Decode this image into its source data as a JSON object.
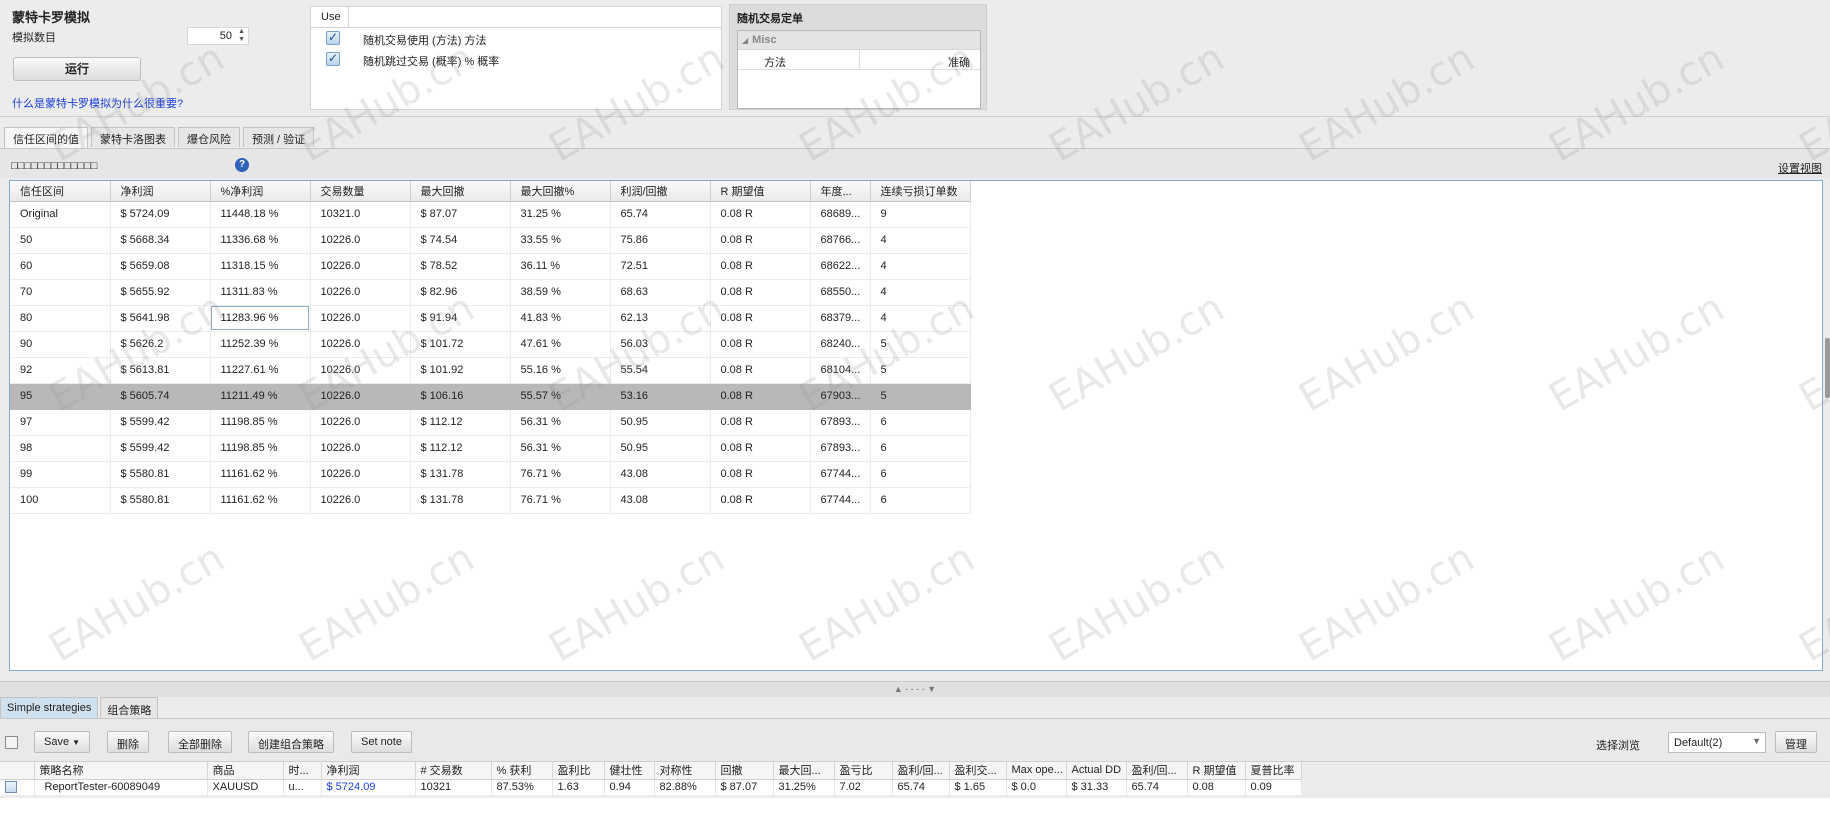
{
  "montecarlo": {
    "title": "蒙特卡罗模拟",
    "count_label": "模拟数目",
    "count_value": "50",
    "run_label": "运行",
    "why_link": "什么是蒙特卡罗模拟为什么很重要?"
  },
  "use_panel": {
    "header": "Use",
    "options": [
      {
        "label": "随机交易使用 (方法) 方法",
        "checked": true
      },
      {
        "label": "随机跳过交易 (概率) % 概率",
        "checked": true
      }
    ]
  },
  "random_panel": {
    "title": "随机交易定单",
    "category": "Misc",
    "row_key": "方法",
    "row_value": "准确"
  },
  "tabs": [
    "信任区间的值",
    "蒙特卡洛图表",
    "爆仓风险",
    "预测 / 验证"
  ],
  "subbar": {
    "placeholder_text": "□□□□□□□□□□□□□",
    "set_view": "设置视图"
  },
  "grid": {
    "columns": [
      "信任区间",
      "净利润",
      "%净利润",
      "交易数量",
      "最大回撤",
      "最大回撤%",
      "利润/回撤",
      "R 期望值",
      "年度...",
      "连续亏损订单数"
    ],
    "rows": [
      [
        "Original",
        "$ 5724.09",
        "11448.18 %",
        "10321.0",
        "$ 87.07",
        "31.25 %",
        "65.74",
        "0.08 R",
        "68689...",
        "9"
      ],
      [
        "50",
        "$ 5668.34",
        "11336.68 %",
        "10226.0",
        "$ 74.54",
        "33.55 %",
        "75.86",
        "0.08 R",
        "68766...",
        "4"
      ],
      [
        "60",
        "$ 5659.08",
        "11318.15 %",
        "10226.0",
        "$ 78.52",
        "36.11 %",
        "72.51",
        "0.08 R",
        "68622...",
        "4"
      ],
      [
        "70",
        "$ 5655.92",
        "11311.83 %",
        "10226.0",
        "$ 82.96",
        "38.59 %",
        "68.63",
        "0.08 R",
        "68550...",
        "4"
      ],
      [
        "80",
        "$ 5641.98",
        "11283.96 %",
        "10226.0",
        "$ 91.94",
        "41.83 %",
        "62.13",
        "0.08 R",
        "68379...",
        "4"
      ],
      [
        "90",
        "$ 5626.2",
        "11252.39 %",
        "10226.0",
        "$ 101.72",
        "47.61 %",
        "56.03",
        "0.08 R",
        "68240...",
        "5"
      ],
      [
        "92",
        "$ 5613.81",
        "11227.61 %",
        "10226.0",
        "$ 101.92",
        "55.16 %",
        "55.54",
        "0.08 R",
        "68104...",
        "5"
      ],
      [
        "95",
        "$ 5605.74",
        "11211.49 %",
        "10226.0",
        "$ 106.16",
        "55.57 %",
        "53.16",
        "0.08 R",
        "67903...",
        "5"
      ],
      [
        "97",
        "$ 5599.42",
        "11198.85 %",
        "10226.0",
        "$ 112.12",
        "56.31 %",
        "50.95",
        "0.08 R",
        "67893...",
        "6"
      ],
      [
        "98",
        "$ 5599.42",
        "11198.85 %",
        "10226.0",
        "$ 112.12",
        "56.31 %",
        "50.95",
        "0.08 R",
        "67893...",
        "6"
      ],
      [
        "99",
        "$ 5580.81",
        "11161.62 %",
        "10226.0",
        "$ 131.78",
        "76.71 %",
        "43.08",
        "0.08 R",
        "67744...",
        "6"
      ],
      [
        "100",
        "$ 5580.81",
        "11161.62 %",
        "10226.0",
        "$ 131.78",
        "76.71 %",
        "43.08",
        "0.08 R",
        "67744...",
        "6"
      ]
    ],
    "selected_row": 7
  },
  "splitter": "▲ - - - - ▼",
  "bottom_tabs": [
    "Simple strategies",
    "组合策略"
  ],
  "toolbar": {
    "save": "Save",
    "delete": "删除",
    "delete_all": "全部删除",
    "create_combo": "创建组合策略",
    "set_note": "Set note",
    "view_label": "选择浏览",
    "view_value": "Default(2)",
    "manage": "管理"
  },
  "strategies": {
    "columns": [
      "策略名称",
      "商品",
      "时...",
      "净利润",
      "# 交易数",
      "% 获利",
      "盈利比",
      "健壮性",
      "对称性",
      "回撤",
      "最大回...",
      "盈亏比",
      "盈利/回...",
      "盈利交...",
      "Max ope...",
      "Actual DD",
      "盈利/回...",
      "R 期望值",
      "夏普比率"
    ],
    "rows": [
      [
        "ReportTester-60089049",
        "XAUUSD",
        "u...",
        "$ 5724.09",
        "10321",
        "87.53%",
        "1.63",
        "0.94",
        "82.88%",
        "$ 87.07",
        "31.25%",
        "7.02",
        "65.74",
        "$ 1.65",
        "$ 0.0",
        "$ 31.33",
        "65.74",
        "0.08",
        "0.09"
      ]
    ]
  },
  "watermark": "EAHub.cn"
}
